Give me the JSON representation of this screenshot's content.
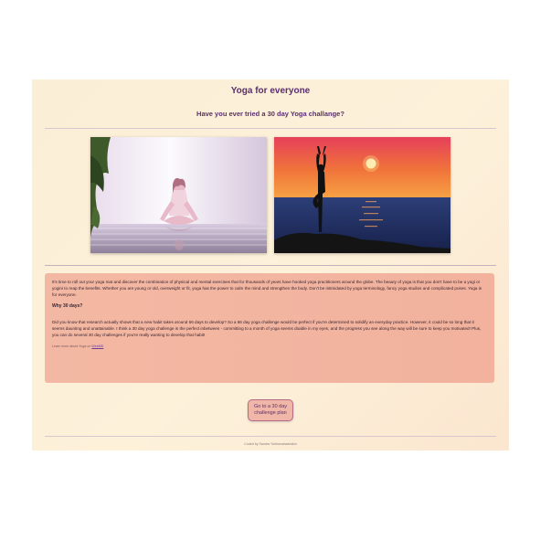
{
  "header": {
    "title": "Yoga for everyone",
    "subtitle": "Have you ever tried a 30 day Yoga challange?"
  },
  "images": [
    {
      "icon": "meditation-photo-icon"
    },
    {
      "icon": "tree-pose-sunset-photo-icon"
    }
  ],
  "content": {
    "intro": "It's time to roll out your yoga mat and discover the combination of physical and mental exercises that for thousands of years have hooked yoga practitioners around the globe. The beauty of yoga is that you don't have to be a yogi or yogini to reap the benefits. Whether you are young or old, overweight or fit, yoga has the power to calm the mind and strengthen the body. Don't be intimidated by yoga terminology, fancy yoga studios and complicated poses. Yoga is for everyone.",
    "heading": "Why 30 days?",
    "body": "Did you know that research actually shows that a new habit takes around 66 days to develop? So a 66 day yoga challenge would be perfect if you're determined to solidify an everyday practice. However, it could be so long that it seems daunting and unattainable. I think a 30 day yoga challenge is the perfect inbetween - committing to a month of yoga seems doable in my eyes, and the progress you see along the way will be sure to keep you motivated! Plus, you can do several 30 day challenges if you're really wanting to develop that habit!",
    "source_prefix": "Learn more about Yoga on",
    "source_link": "WebMD"
  },
  "cta": {
    "line1": "Go to a 30 day",
    "line2": "challenge plan"
  },
  "footer": {
    "credit": "Coded by Sandra Yufeiwoahaeiulkin"
  }
}
